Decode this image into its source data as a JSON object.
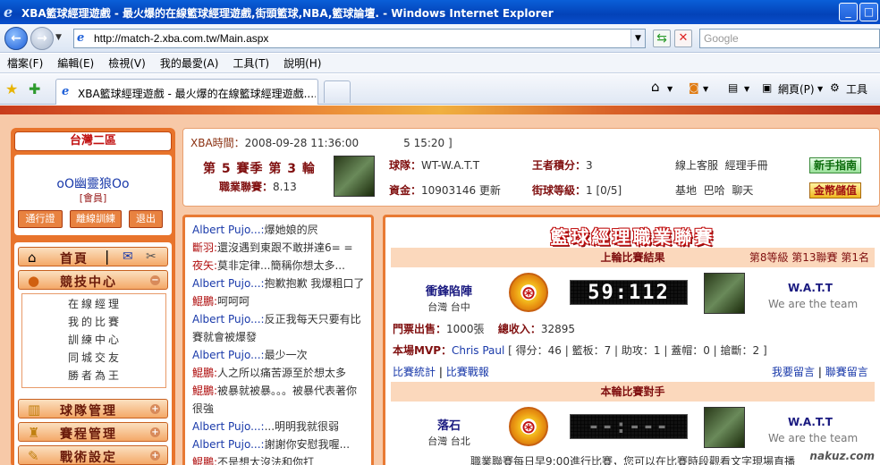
{
  "window": {
    "title": "XBA籃球經理遊戲 - 最火爆的在線籃球經理遊戲,街頭籃球,NBA,籃球論壇. - Windows Internet Explorer"
  },
  "address": {
    "url": "http://match-2.xba.com.tw/Main.aspx",
    "search_placeholder": "Google"
  },
  "menu": [
    "檔案(F)",
    "編輯(E)",
    "檢視(V)",
    "我的最愛(A)",
    "工具(T)",
    "說明(H)"
  ],
  "tab": {
    "title": "XBA籃球經理遊戲 - 最火爆的在線籃球經理遊戲...."
  },
  "commands": {
    "page": "網頁(P)",
    "tools": "工具"
  },
  "left": {
    "zone": "台灣二區",
    "username": "oO幽靈狼Oo",
    "role": "[會員]",
    "buttons": [
      "通行證",
      "離線訓練",
      "退出"
    ],
    "home": "首頁",
    "menus": [
      "競技中心",
      "球隊管理",
      "賽程管理",
      "戰術設定"
    ],
    "sub": [
      "在線經理",
      "我的比賽",
      "訓練中心",
      "同城交友",
      "勝者為王"
    ]
  },
  "info": {
    "time_label": "XBA時間：",
    "time": "2008-09-28 11:36:00",
    "extra": "5 15:20 ]",
    "season": "第 5 賽季 第 3 輪",
    "pro_label": "職業聯賽：",
    "pro_value": "8.13",
    "team_label": "球隊：",
    "team_value": "WT-W.A.T.T",
    "king_label": "王者積分：",
    "king_value": "3",
    "money_label": "資金：",
    "money_value": "10903146",
    "update": "更新",
    "level_label": "街球等級：",
    "level_value": "1 [0/5]",
    "online": "線上客服",
    "manual": "經理手冊",
    "base": "基地",
    "bar": "巴哈",
    "chat": "聊天",
    "guide_btn": "新手指南",
    "gold_btn": "金幣儲值"
  },
  "chat": [
    {
      "name": "Albert Pujo...:",
      "text": "爆她娘的屄",
      "c": "nb"
    },
    {
      "name": "斷羽:",
      "text": "還沒遇到東跟不敢拼達6= =",
      "c": "nr"
    },
    {
      "name": "夜矢:",
      "text": "莫非定律...簡稱你想太多...",
      "c": "nr"
    },
    {
      "name": "Albert Pujo...:",
      "text": "抱歉抱歉 我爆粗口了",
      "c": "nb"
    },
    {
      "name": "鯤鵬:",
      "text": "呵呵呵",
      "c": "nr"
    },
    {
      "name": "Albert Pujo...:",
      "text": "反正我每天只要有比賽就會被爆發",
      "c": "nb"
    },
    {
      "name": "Albert Pujo...:",
      "text": "最少一次",
      "c": "nb"
    },
    {
      "name": "鯤鵬:",
      "text": "人之所以痛苦源至於想太多",
      "c": "nr"
    },
    {
      "name": "鯤鵬:",
      "text": "被暴就被暴。。。被暴代表著你很強",
      "c": "nr"
    },
    {
      "name": "Albert Pujo...:",
      "text": "...明明我就很弱",
      "c": "nb"
    },
    {
      "name": "Albert Pujo...:",
      "text": "謝謝你安慰我喔...",
      "c": "nb"
    },
    {
      "name": "鯤鵬:",
      "text": "不是想太沒法和你打",
      "c": "nr"
    }
  ],
  "main": {
    "league_title": "籃球經理職業聯賽",
    "last_title": "上輪比賽結果",
    "last_right": "第8等級 第13聯賽 第1名",
    "home_team": "衝鋒陷陣",
    "home_loc": "台灣 台中",
    "score": "59:112",
    "away_team": "W.A.T.T",
    "away_slogan": "We are the team",
    "ticket_label": "門票出售：",
    "ticket_value": "1000張",
    "income_label": "總收入：",
    "income_value": "32895",
    "mvp_label": "本場MVP：",
    "mvp_name": "Chris Paul",
    "mvp_stats": "[ 得分：46 | 籃板：7 | 助攻：1 | 蓋帽：0 | 搶斷：2 ]",
    "stats_link": "比賽統計",
    "war_link": "比賽戰報",
    "msg_link": "我要留言",
    "board_link": "聯賽留言",
    "next_title": "本輪比賽對手",
    "next_team": "落石",
    "next_loc": "台灣 台北",
    "next_score": "--:---",
    "next_away": "W.A.T.T",
    "next_slogan": "We are the team",
    "footer": "職業聯賽每日早9:00進行比賽，您可以在比賽時段觀看文字現場直播"
  },
  "watermark": "nakuz.com"
}
